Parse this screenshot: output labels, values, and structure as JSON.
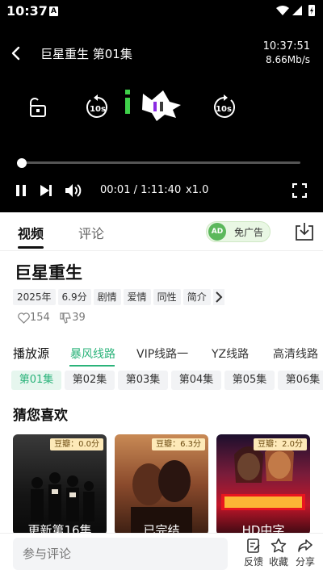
{
  "status": {
    "time": "10:37",
    "app_badge": "A"
  },
  "player": {
    "title": "巨星重生 第01集",
    "clock": "10:37:51",
    "net_speed": "8.66Mb/s",
    "rewind_label": "10s",
    "forward_label": "10s",
    "progress": 0.0,
    "time_text": "00:01 / 1:11:40",
    "speed": "x1.0"
  },
  "tabs": {
    "video": "视频",
    "comment": "评论",
    "no_ads": "免广告",
    "ad_badge": "AD"
  },
  "show": {
    "title": "巨星重生",
    "tags": [
      "2025年",
      "6.9分",
      "剧情",
      "爱情",
      "同性",
      "简介"
    ],
    "likes": "154",
    "dislikes": "39"
  },
  "sources": {
    "label": "播放源",
    "items": [
      "暴风线路",
      "VIP线路一",
      "YZ线路",
      "高清线路"
    ],
    "active": 0
  },
  "episodes": [
    "第01集",
    "第02集",
    "第03集",
    "第04集",
    "第05集",
    "第06集"
  ],
  "recommend": {
    "title": "猜您喜欢",
    "cards": [
      {
        "rating": "豆瓣：0.0分",
        "title": "更新第16集"
      },
      {
        "rating": "豆瓣：6.3分",
        "title": "已完结"
      },
      {
        "rating": "豆瓣：2.0分",
        "title": "HD中字"
      }
    ]
  },
  "bottom": {
    "comment_placeholder": "参与评论",
    "feedback": "反馈",
    "favorite": "收藏",
    "share": "分享"
  },
  "colors": {
    "accent": "#2bb37a",
    "player_bg": "#000000"
  }
}
